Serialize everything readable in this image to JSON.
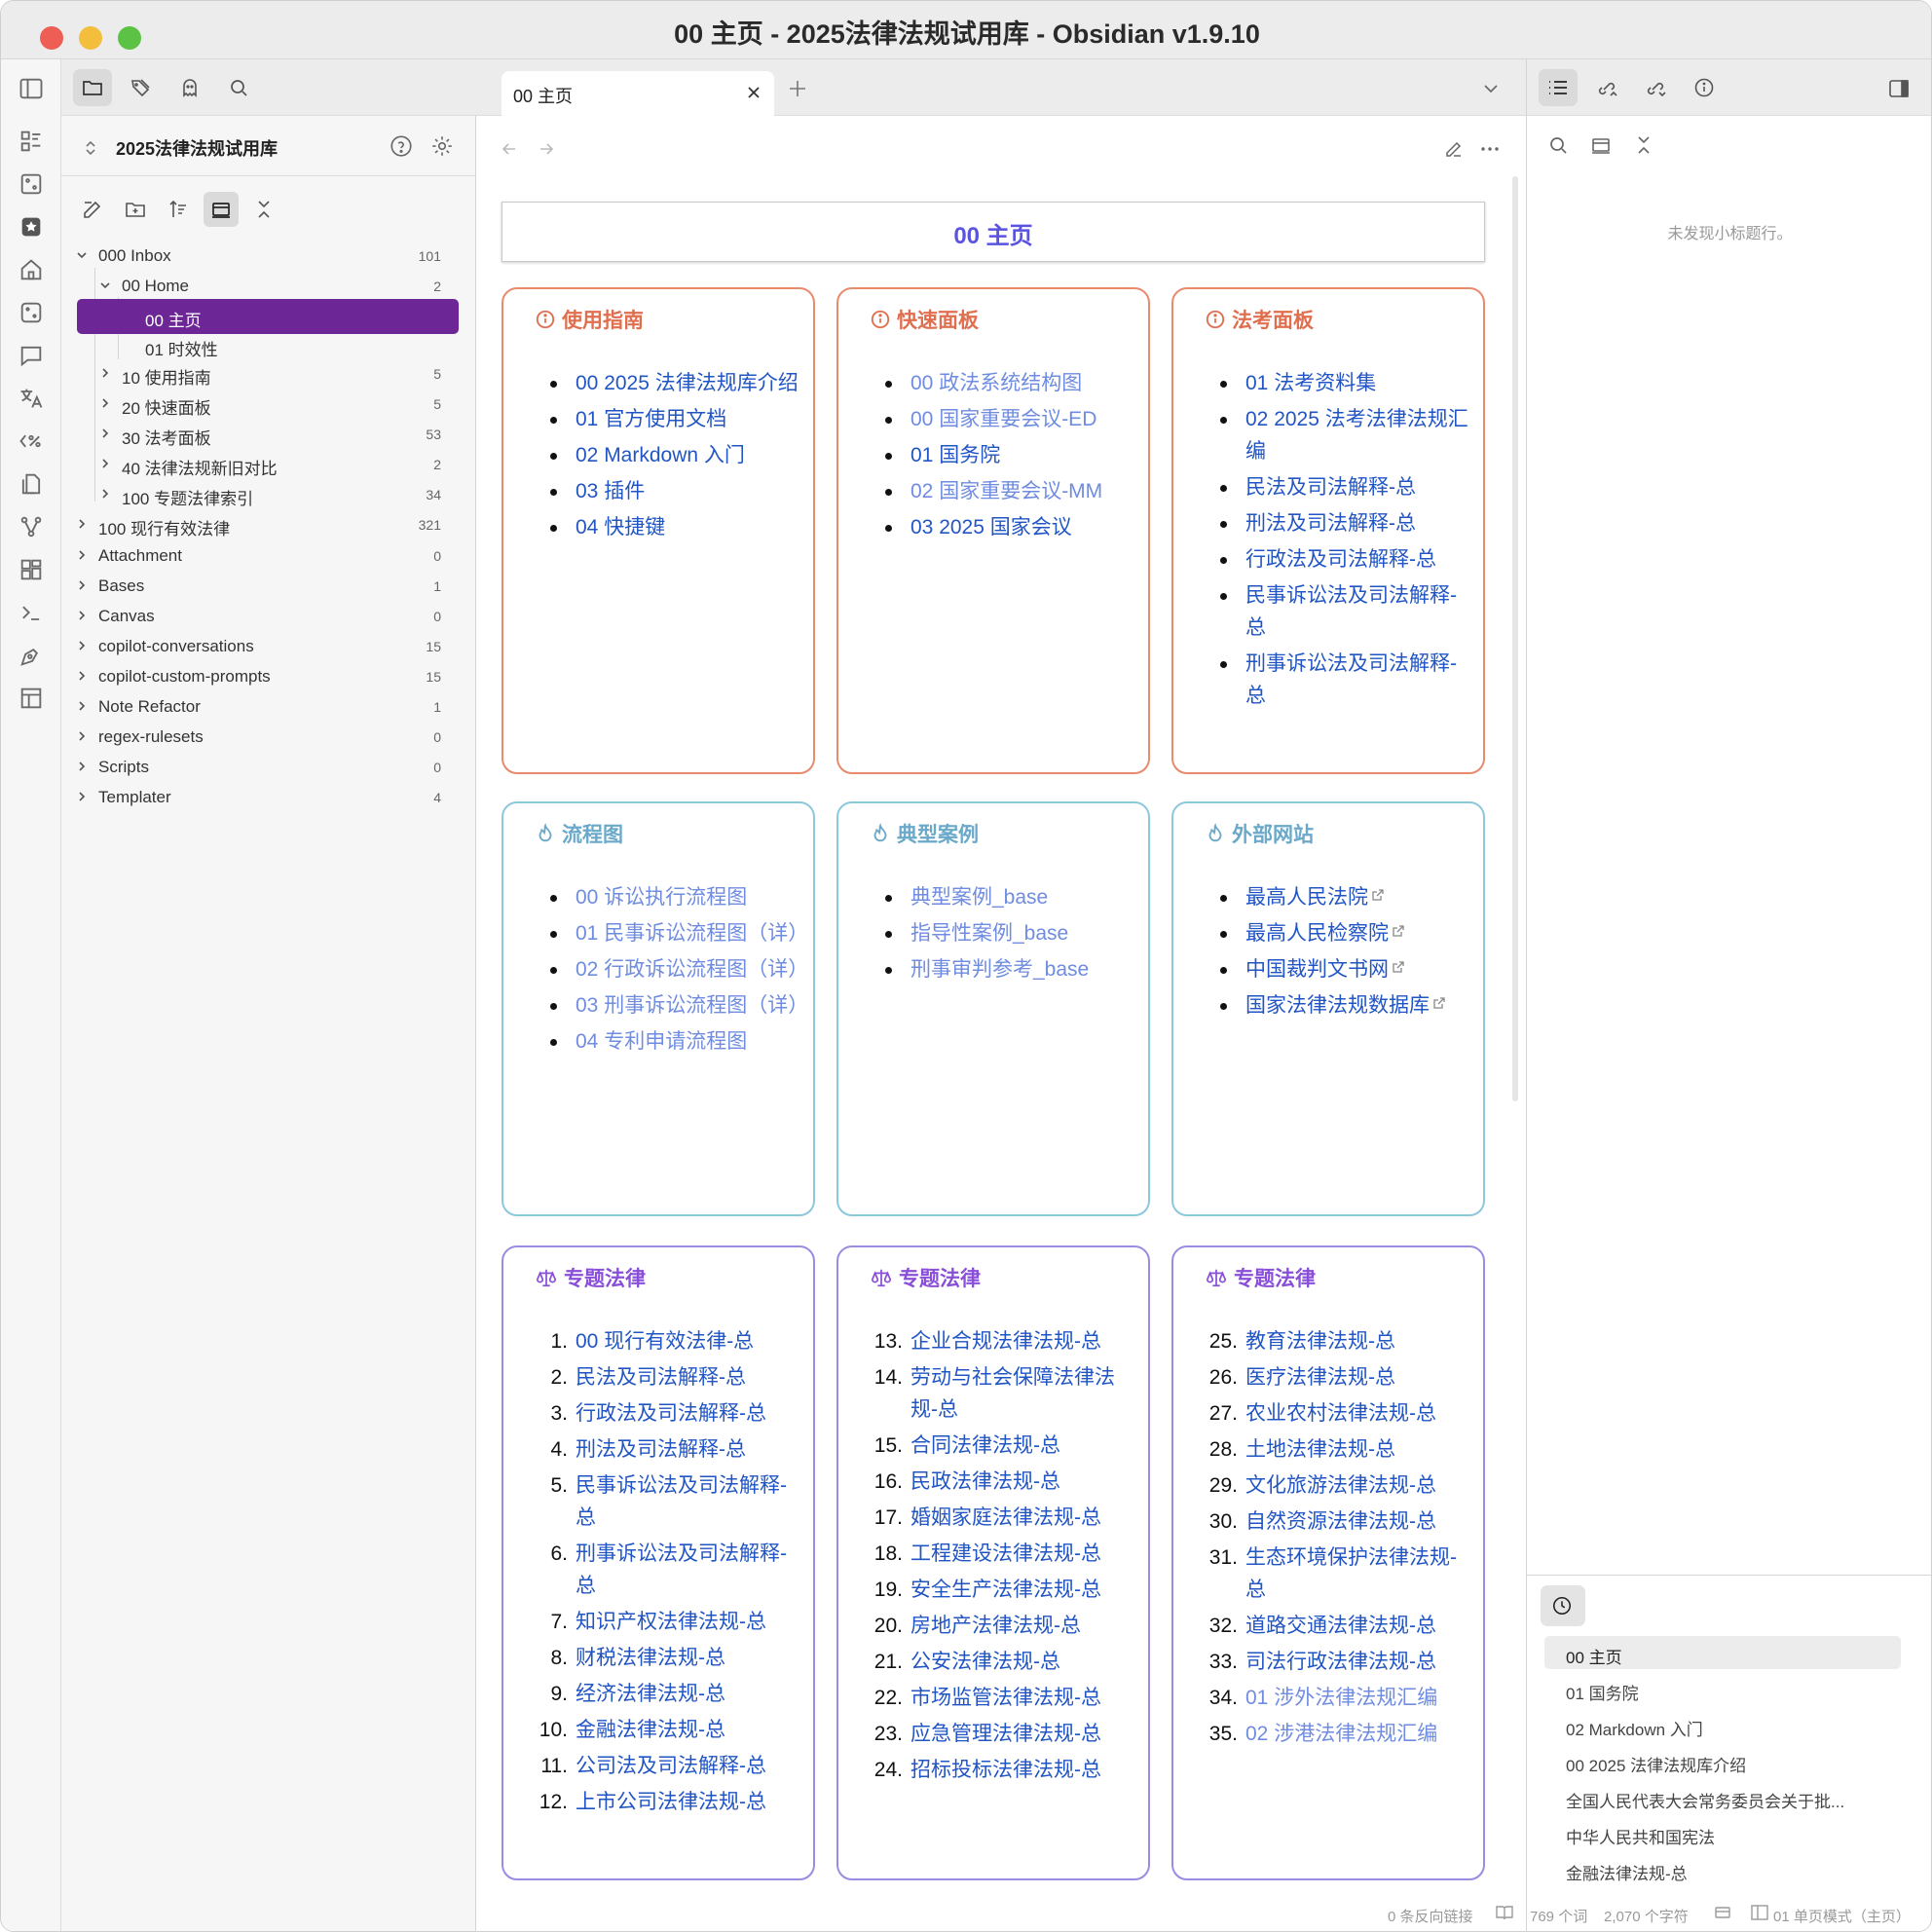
{
  "window": {
    "title": "00 主页 - 2025法律法规试用库 - Obsidian v1.9.10"
  },
  "colors": {
    "accent": "#6c2696",
    "card_orange": "#e88a6d",
    "card_blue": "#8cc8dc",
    "card_purple": "#9a8ce0",
    "heading_orange": "#e06f4f",
    "heading_blue": "#6aa9c9",
    "heading_purple": "#8a4fd8"
  },
  "sidebar": {
    "vault_name": "2025法律法规试用库",
    "tree": [
      {
        "label": "000 Inbox",
        "count": "101"
      },
      {
        "label": "00 Home",
        "count": "2"
      },
      {
        "label": "00 主页",
        "count": ""
      },
      {
        "label": "01 时效性",
        "count": ""
      },
      {
        "label": "10 使用指南",
        "count": "5"
      },
      {
        "label": "20 快速面板",
        "count": "5"
      },
      {
        "label": "30 法考面板",
        "count": "53"
      },
      {
        "label": "40 法律法规新旧对比",
        "count": "2"
      },
      {
        "label": "100 专题法律索引",
        "count": "34"
      },
      {
        "label": "100 现行有效法律",
        "count": "321"
      },
      {
        "label": "Attachment",
        "count": "0"
      },
      {
        "label": "Bases",
        "count": "1"
      },
      {
        "label": "Canvas",
        "count": "0"
      },
      {
        "label": "copilot-conversations",
        "count": "15"
      },
      {
        "label": "copilot-custom-prompts",
        "count": "15"
      },
      {
        "label": "Note Refactor",
        "count": "1"
      },
      {
        "label": "regex-rulesets",
        "count": "0"
      },
      {
        "label": "Scripts",
        "count": "0"
      },
      {
        "label": "Templater",
        "count": "4"
      }
    ]
  },
  "editor": {
    "tab_title": "00 主页",
    "page_title": "00 主页",
    "cards": [
      {
        "title": "使用指南",
        "icon": "info-icon",
        "items": [
          "00 2025 法律法规库介绍",
          "01 官方使用文档",
          "02 Markdown 入门",
          "03 插件",
          "04 快捷键"
        ]
      },
      {
        "title": "快速面板",
        "icon": "info-icon",
        "items": [
          "00 政法系统结构图",
          "00 国家重要会议-ED",
          "01 国务院",
          "02 国家重要会议-MM",
          "03 2025 国家会议"
        ]
      },
      {
        "title": "法考面板",
        "icon": "info-icon",
        "items": [
          "01 法考资料集",
          "02 2025 法考法律法规汇编",
          "民法及司法解释-总",
          "刑法及司法解释-总",
          "行政法及司法解释-总",
          "民事诉讼法及司法解释-总",
          "刑事诉讼法及司法解释-总"
        ]
      },
      {
        "title": "流程图",
        "icon": "flame-icon",
        "items": [
          "00 诉讼执行流程图",
          "01 民事诉讼流程图（详）",
          "02 行政诉讼流程图（详）",
          "03 刑事诉讼流程图（详）",
          "04 专利申请流程图"
        ]
      },
      {
        "title": "典型案例",
        "icon": "flame-icon",
        "items": [
          "典型案例_base",
          "指导性案例_base",
          "刑事审判参考_base"
        ]
      },
      {
        "title": "外部网站",
        "icon": "flame-icon",
        "items": [
          "最高人民法院",
          "最高人民检察院",
          "中国裁判文书网",
          "国家法律法规数据库"
        ]
      },
      {
        "title": "专题法律",
        "icon": "scales-icon",
        "items": [
          "00 现行有效法律-总",
          "民法及司法解释-总",
          "行政法及司法解释-总",
          "刑法及司法解释-总",
          "民事诉讼法及司法解释-总",
          "刑事诉讼法及司法解释-总",
          "知识产权法律法规-总",
          "财税法律法规-总",
          "经济法律法规-总",
          "金融法律法规-总",
          "公司法及司法解释-总",
          "上市公司法律法规-总"
        ]
      },
      {
        "title": "专题法律",
        "icon": "scales-icon",
        "items": [
          "企业合规法律法规-总",
          "劳动与社会保障法律法规-总",
          "合同法律法规-总",
          "民政法律法规-总",
          "婚姻家庭法律法规-总",
          "工程建设法律法规-总",
          "安全生产法律法规-总",
          "房地产法律法规-总",
          "公安法律法规-总",
          "市场监管法律法规-总",
          "应急管理法律法规-总",
          "招标投标法律法规-总"
        ]
      },
      {
        "title": "专题法律",
        "icon": "scales-icon",
        "items": [
          "教育法律法规-总",
          "医疗法律法规-总",
          "农业农村法律法规-总",
          "土地法律法规-总",
          "文化旅游法律法规-总",
          "自然资源法律法规-总",
          "生态环境保护法律法规-总",
          "道路交通法律法规-总",
          "司法行政法律法规-总",
          "01 涉外法律法规汇编",
          "02 涉港法律法规汇编"
        ]
      }
    ]
  },
  "right": {
    "outline_empty": "未发现小标题行。",
    "recent": [
      "00 主页",
      "01 国务院",
      "02 Markdown 入门",
      "00 2025 法律法规库介绍",
      "全国人民代表大会常务委员会关于批...",
      "中华人民共和国宪法",
      "金融法律法规-总"
    ]
  },
  "status": {
    "backlinks": "0 条反向链接",
    "words": "769 个词",
    "chars": "2,070 个字符",
    "mode": "01 单页模式（主页）"
  }
}
